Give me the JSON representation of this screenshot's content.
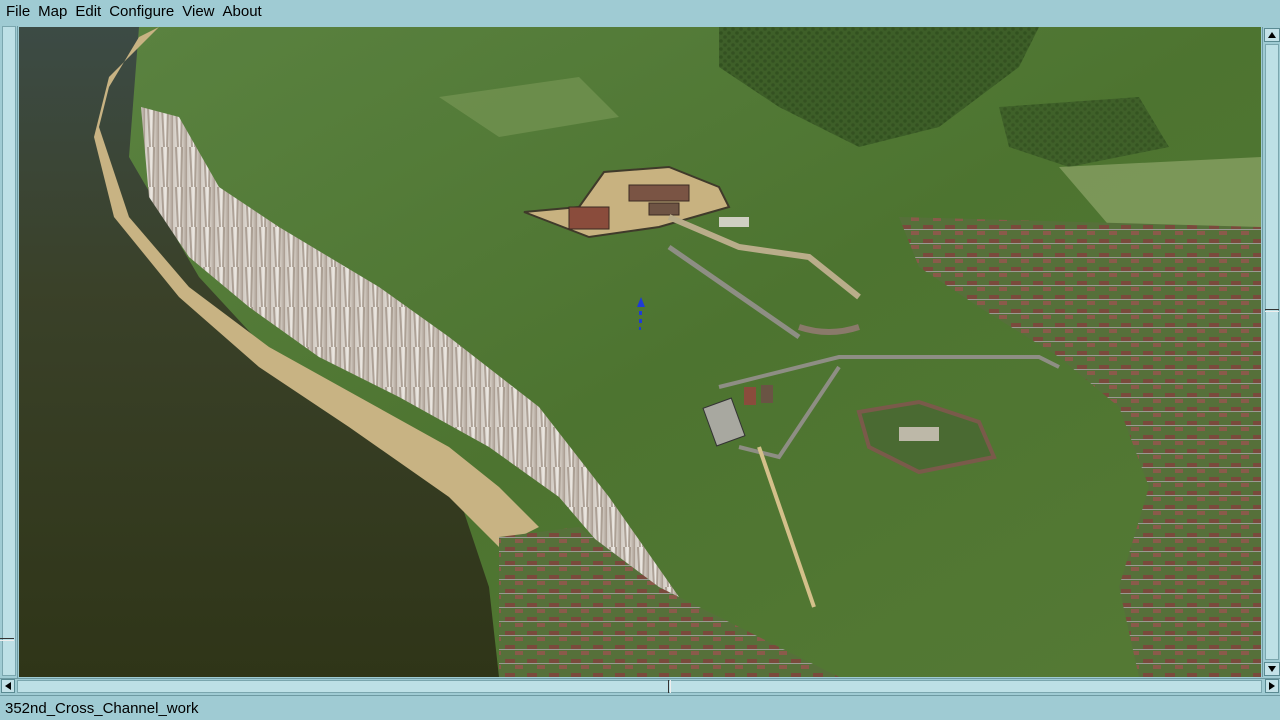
{
  "menubar": {
    "items": [
      {
        "label": "File"
      },
      {
        "label": "Map"
      },
      {
        "label": "Edit"
      },
      {
        "label": "Configure"
      },
      {
        "label": "View"
      },
      {
        "label": "About"
      }
    ]
  },
  "status": {
    "text": "352nd_Cross_Channel_work"
  },
  "colors": {
    "chrome": "#9fcbd3",
    "sea": "#3d4228",
    "land": "#4f7a32",
    "cliff": "#e4e1dc",
    "beach": "#c8b383",
    "marker": "#1f3bd6"
  }
}
